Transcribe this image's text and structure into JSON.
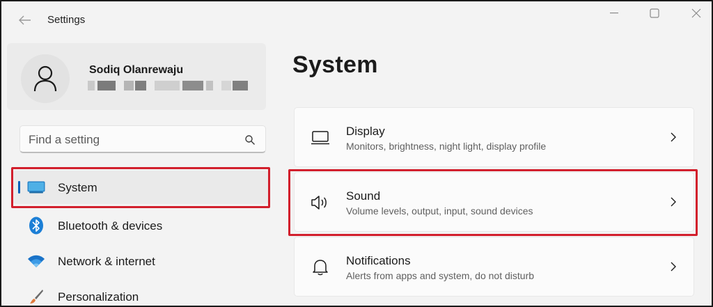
{
  "window": {
    "title": "Settings",
    "controls": [
      "minimize",
      "maximize",
      "close"
    ]
  },
  "profile": {
    "name": "Sodiq Olanrewaju",
    "icon": "person-icon"
  },
  "search": {
    "placeholder": "Find a setting",
    "icon": "search-icon"
  },
  "sidebar": {
    "items": [
      {
        "label": "System",
        "icon": "monitor-icon",
        "selected": true
      },
      {
        "label": "Bluetooth & devices",
        "icon": "bluetooth-icon"
      },
      {
        "label": "Network & internet",
        "icon": "wifi-icon"
      },
      {
        "label": "Personalization",
        "icon": "brush-icon"
      }
    ]
  },
  "main": {
    "title": "System",
    "cards": [
      {
        "title": "Display",
        "subtitle": "Monitors, brightness, night light, display profile",
        "icon": "display-icon"
      },
      {
        "title": "Sound",
        "subtitle": "Volume levels, output, input, sound devices",
        "icon": "speaker-icon"
      },
      {
        "title": "Notifications",
        "subtitle": "Alerts from apps and system, do not disturb",
        "icon": "bell-icon"
      }
    ]
  },
  "colors": {
    "accent": "#005fb8",
    "highlight": "#d21f2c",
    "background": "#f3f3f3",
    "card": "#fbfbfb"
  }
}
